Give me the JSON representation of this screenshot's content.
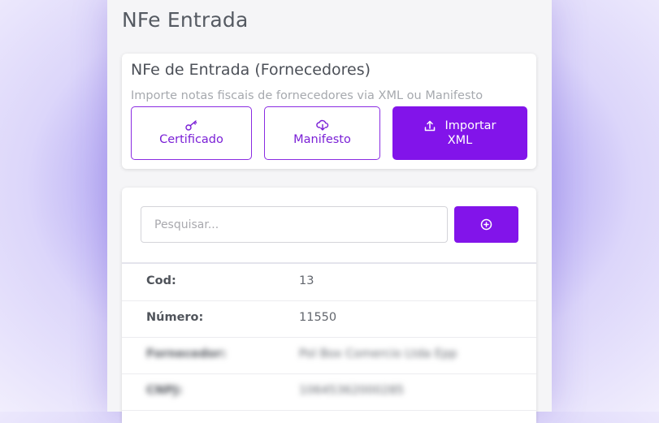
{
  "page": {
    "title": "NFe Entrada"
  },
  "import_card": {
    "title": "NFe de Entrada (Fornecedores)",
    "subtitle": "Importe notas fiscais de fornecedores via XML ou Manifesto",
    "buttons": {
      "certificado": "Certificado",
      "manifesto": "Manifesto",
      "importar_line1": "Importar",
      "importar_line2": "XML"
    },
    "icons": {
      "certificado": "key-icon",
      "manifesto": "cloud-download-icon",
      "importar": "upload-icon"
    }
  },
  "list_card": {
    "search": {
      "placeholder": "Pesquisar...",
      "value": ""
    },
    "add_icon": "plus-circle-icon",
    "rows": [
      {
        "label": "Cod:",
        "value": "13"
      },
      {
        "label": "Número:",
        "value": "11550"
      },
      {
        "label": "Fornecedor:",
        "value": "Pol Box Comercio Ltda Epp"
      },
      {
        "label": "CNPJ:",
        "value": "10645362000285"
      }
    ]
  },
  "colors": {
    "accent": "#8214ea",
    "accent_outline": "#8a2be2",
    "background": "#f5f5f7"
  }
}
